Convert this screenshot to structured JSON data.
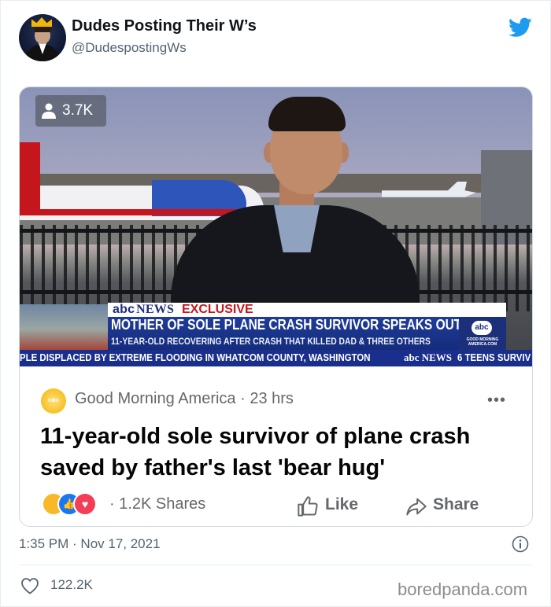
{
  "tweet": {
    "display_name": "Dudes Posting Their W’s",
    "handle": "@DudespostingWs",
    "timestamp": "1:35 PM · Nov 17, 2021",
    "like_count": "122.2K"
  },
  "video": {
    "view_count": "3.7K",
    "lower_third": {
      "brand": "abc",
      "brand_news": "NEWS",
      "exclusive_label": "EXCLUSIVE",
      "headline": "MOTHER OF SOLE PLANE CRASH SURVIVOR SPEAKS OUT",
      "subline": "11-YEAR-OLD RECOVERING AFTER CRASH THAT KILLED DAD & THREE OTHERS",
      "logo_abc": "abc",
      "logo_gma": "GOOD MORNING AMERICA.COM"
    },
    "ticker": {
      "text": "PLE DISPLACED BY EXTREME FLOODING IN WHATCOM COUNTY, WASHINGTON",
      "brand": "abc NEWS",
      "right_text": "6 TEENS SURVIV"
    }
  },
  "fb_post": {
    "source": "Good Morning America · 23 hrs",
    "more_label": "•••",
    "headline": "11-year-old sole survivor of plane crash saved by father's last 'bear hug'",
    "shares": "· 1.2K Shares",
    "like_label": "Like",
    "share_label": "Share"
  },
  "watermark": "boredpanda.com",
  "colors": {
    "twitter_blue": "#1d9bf0",
    "abc_blue": "#1b2f7a",
    "exclusive_red": "#c4161c",
    "fb_gray": "#65676b"
  },
  "icons": [
    "twitter-bird-icon",
    "person-icon",
    "like-thumb-icon",
    "share-arrow-icon",
    "info-icon",
    "heart-icon"
  ]
}
